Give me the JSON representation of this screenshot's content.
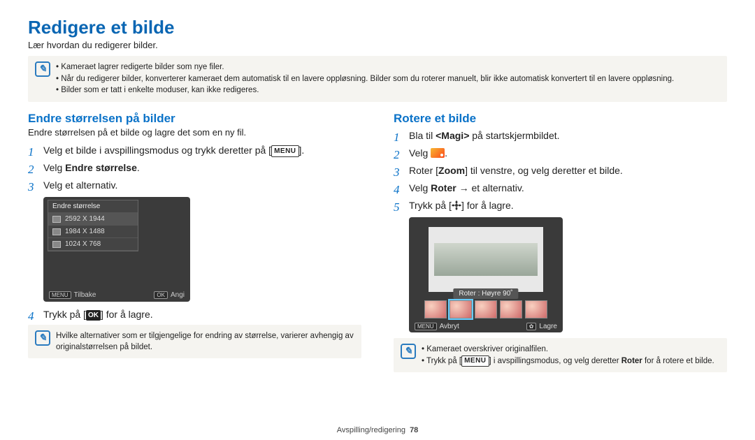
{
  "page_title": "Redigere et bilde",
  "intro": "Lær hvordan du redigerer bilder.",
  "top_notes": [
    "Kameraet lagrer redigerte bilder som nye filer.",
    "Når du redigerer bilder, konverterer kameraet dem automatisk til en lavere oppløsning. Bilder som du roterer manuelt, blir ikke automatisk konvertert til en lavere oppløsning.",
    "Bilder som er tatt i enkelte moduser, kan ikke redigeres."
  ],
  "left": {
    "title": "Endre størrelsen på bilder",
    "sub": "Endre størrelsen på et bilde og lagre det som en ny fil.",
    "steps": {
      "s1_a": "Velg et bilde i avspillingsmodus og trykk deretter på [",
      "s1_menu": "MENU",
      "s1_b": "].",
      "s2_a": "Velg ",
      "s2_bold": "Endre størrelse",
      "s2_b": ".",
      "s3": "Velg et alternativ.",
      "s4_a": "Trykk på [",
      "s4_ok": "OK",
      "s4_b": "] for å lagre."
    },
    "shot": {
      "panel_title": "Endre størrelse",
      "opts": [
        "2592 X 1944",
        "1984 X 1488",
        "1024 X 768"
      ],
      "footer_left_badge": "MENU",
      "footer_left_label": "Tilbake",
      "footer_right_badge": "OK",
      "footer_right_label": "Angi"
    },
    "bottom_note": "Hvilke alternativer som er tilgjengelige for endring av størrelse, varierer avhengig av originalstørrelsen på bildet."
  },
  "right": {
    "title": "Rotere et bilde",
    "steps": {
      "s1_a": "Bla til ",
      "s1_bold": "<Magi>",
      "s1_b": " på startskjermbildet.",
      "s2_a": "Velg ",
      "s2_b": ".",
      "s3_a": "Roter [",
      "s3_bold": "Zoom",
      "s3_b": "] til venstre, og velg deretter et bilde.",
      "s4_a": "Velg ",
      "s4_bold": "Roter",
      "s4_b": " → et alternativ.",
      "s5_a": "Trykk på [",
      "s5_b": "] for å lagre."
    },
    "shot": {
      "rotate_label": "Roter : Høyre 90˚",
      "footer_left_badge": "MENU",
      "footer_left_label": "Avbryt",
      "footer_right_label": "Lagre"
    },
    "bottom_notes": [
      "Kameraet overskriver originalfilen."
    ],
    "bottom_note_2_a": "Trykk på [",
    "bottom_note_2_menu": "MENU",
    "bottom_note_2_b": "] i avspillingsmodus, og velg deretter ",
    "bottom_note_2_bold": "Roter",
    "bottom_note_2_c": " for å rotere et bilde."
  },
  "footer": {
    "section": "Avspilling/redigering",
    "page": "78"
  }
}
